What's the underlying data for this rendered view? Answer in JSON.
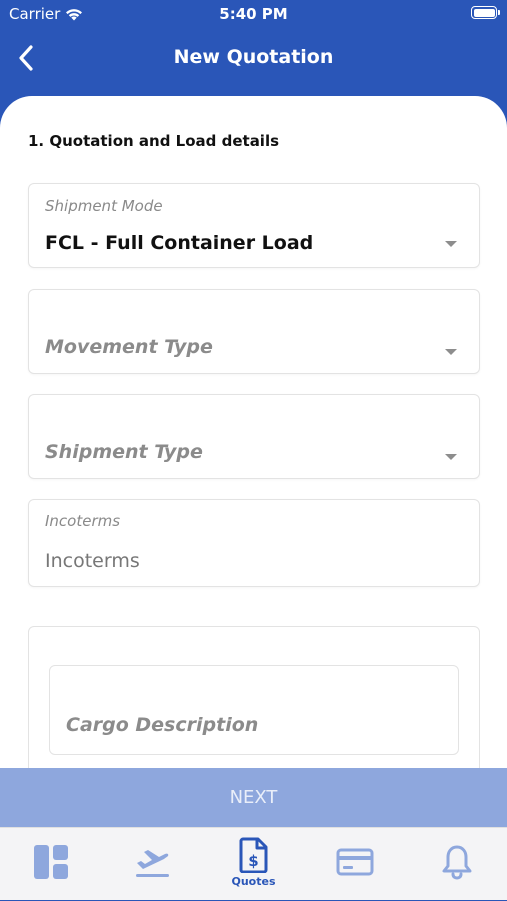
{
  "status_bar": {
    "carrier": "Carrier",
    "time": "5:40 PM"
  },
  "nav": {
    "title": "New Quotation",
    "back_icon": "chevron-left-icon"
  },
  "section": {
    "title": "1. Quotation and Load details"
  },
  "form": {
    "shipment_mode": {
      "label": "Shipment Mode",
      "value": "FCL - Full Container Load"
    },
    "movement_type": {
      "placeholder": "Movement Type"
    },
    "shipment_type": {
      "placeholder": "Shipment Type"
    },
    "incoterms": {
      "label": "Incoterms",
      "value": "Incoterms"
    },
    "cargo_description": {
      "placeholder": "Cargo Description"
    }
  },
  "next_button": {
    "label": "NEXT"
  },
  "tabs": [
    {
      "icon": "dashboard-icon",
      "label": ""
    },
    {
      "icon": "flight-departure-icon",
      "label": ""
    },
    {
      "icon": "quote-document-icon",
      "label": "Quotes",
      "active": true
    },
    {
      "icon": "payment-card-icon",
      "label": ""
    },
    {
      "icon": "bell-icon",
      "label": ""
    }
  ],
  "colors": {
    "primary": "#2a56b8",
    "tab_inactive": "#8ea7dd",
    "next_disabled": "#8ea7dd"
  }
}
